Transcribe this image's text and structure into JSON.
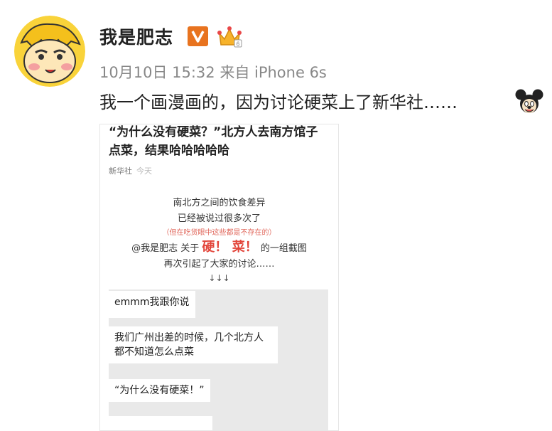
{
  "user": {
    "name": "我是肥志"
  },
  "meta": {
    "time": "10月10日 15:32",
    "source": "来自 iPhone 6s"
  },
  "post": {
    "text": "我一个画漫画的，因为讨论硬菜上了新华社……"
  },
  "icons": {
    "avatar": "cartoon-avatar",
    "verified": "verified-v-badge",
    "vip": "vip-crown-badge",
    "emoji": "mickey-emoji"
  },
  "colors": {
    "verified": "#e8731f",
    "crown": "#f7b32b",
    "red_text": "#e2453a"
  },
  "screenshot": {
    "title": "“为什么没有硬菜？”北方人去南方馆子点菜，结果哈哈哈哈哈",
    "source": "新华社",
    "day": "今天",
    "lines": [
      "南北方之间的饮食差异",
      "已经被说过很多次了"
    ],
    "note": "（但在吃货眼中这些都是不存在的）",
    "mention_pre": "@我是肥志 关于",
    "mention_big": "硬！ 菜！",
    "mention_post": "的一组截图",
    "line_after": "再次引起了大家的讨论……",
    "arrows": "↓↓↓",
    "chat": [
      "emmm我跟你说",
      "我们广州出差的时候，几个北方人都不知道怎么点菜",
      "“为什么没有硬菜！”"
    ]
  }
}
